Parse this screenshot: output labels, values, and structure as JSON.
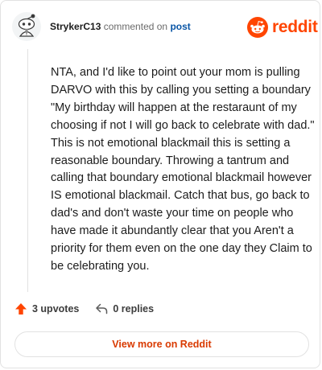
{
  "header": {
    "username": "StrykerC13",
    "commented_text": "commented on",
    "post_link": "post",
    "logo_wordmark": "reddit",
    "brand_color": "#ff4500"
  },
  "comment": {
    "body": "NTA, and I'd like to point out your mom is pulling DARVO with this by calling you setting a boundary \"My birthday will happen at the restaraunt of my choosing if not I will go back to celebrate with dad.\" This is not emotional blackmail this is setting a reasonable boundary. Throwing a tantrum and calling that boundary emotional blackmail however IS emotional blackmail. Catch that bus, go back to dad's and don't waste your time on people who have made it abundantly clear that you Aren't a priority for them even on the one day they Claim to be celebrating you."
  },
  "actions": {
    "upvotes_label": "3 upvotes",
    "upvote_icon": "arrow-up-icon",
    "replies_label": "0 replies",
    "reply_icon": "reply-arrow-icon"
  },
  "footer": {
    "view_more_label": "View more on Reddit",
    "accent_color": "#d93a00"
  }
}
